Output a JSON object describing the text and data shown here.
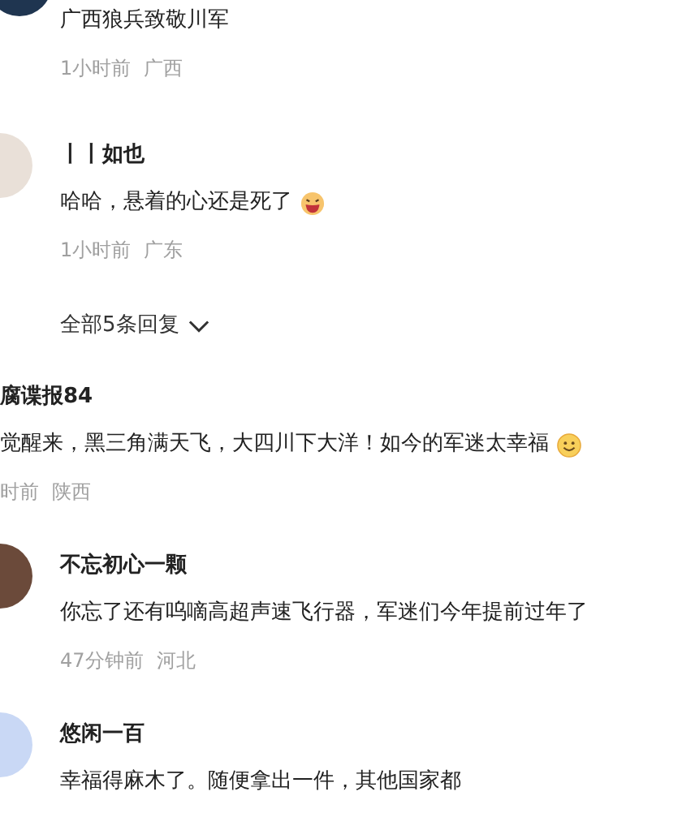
{
  "comments": [
    {
      "kind": "full",
      "avatar": {
        "color": "#1f3550"
      },
      "text": "广西狼兵致敬川军",
      "time": "1小时前",
      "location": "广西"
    },
    {
      "kind": "full",
      "avatar": {
        "color": "#e9e0d8"
      },
      "name": "丨丨如也",
      "text": "哈哈，悬着的心还是死了",
      "emoji": {
        "kind": "laugh"
      },
      "time": "1小时前",
      "location": "广东",
      "replies": "全部5条回复"
    },
    {
      "kind": "clipped",
      "name": "腐谍报84",
      "text": "觉醒来，黑三角满天飞，大四川下大洋！如今的军迷太幸福",
      "emoji": {
        "kind": "smile"
      },
      "time": "时前",
      "location": "陕西"
    },
    {
      "kind": "full",
      "avatar": {
        "color": "#6b4a3a"
      },
      "name": "不忘初心一颗",
      "text": "你忘了还有呜嘀高超声速飞行器，军迷们今年提前过年了",
      "time": "47分钟前",
      "location": "河北"
    },
    {
      "kind": "full",
      "avatar": {
        "color": "#c9d8f5"
      },
      "name": "悠闲一百",
      "text": "幸福得麻木了。随便拿出一件，其他国家都"
    }
  ]
}
